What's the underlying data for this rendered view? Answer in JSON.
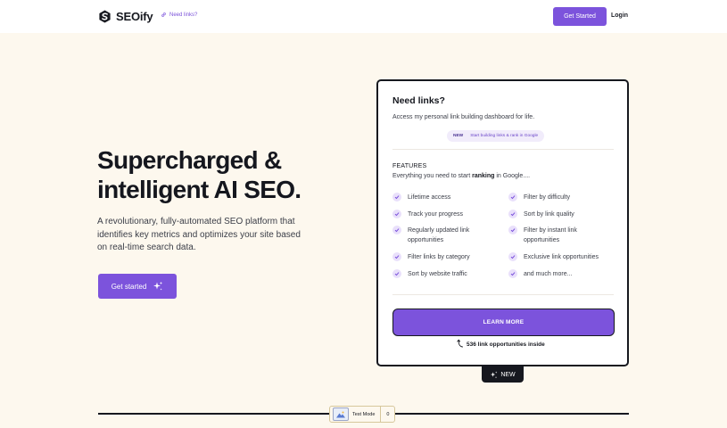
{
  "header": {
    "brand": "SEOify",
    "need_links_label": "Need links?",
    "get_started_label": "Get Started",
    "login_label": "Login"
  },
  "hero": {
    "title_line1": "Supercharged &",
    "title_line2": "intelligent AI SEO.",
    "description": "A revolutionary, fully-automated SEO platform that identifies key metrics and optimizes your site based on real-time search data.",
    "cta_label": "Get started"
  },
  "card": {
    "title": "Need links?",
    "subtitle": "Access my personal link building dashboard for life.",
    "badge_new": "NEW",
    "badge_text": "Start building links & rank in Google",
    "features_heading": "FEATURES",
    "features_sub_pre": "Everything you need to start ",
    "features_sub_bold": "ranking",
    "features_sub_post": " in Google....",
    "features": [
      "Lifetime access",
      "Filter by difficulty",
      "Track your progress",
      "Sort by link quality",
      "Regularly updated link opportunities",
      "Filter by instant link opportunities",
      "Filter links by category",
      "Exclusive link opportunities",
      "Sort by website traffic",
      "and much more..."
    ],
    "learn_more_label": "LEARN MORE",
    "opportunities_text": "536 link opportunities inside"
  },
  "new_tag": "NEW",
  "test_mode": {
    "label": "Test Mode",
    "count": "0"
  },
  "colors": {
    "accent": "#7c53dc",
    "background": "#fdf8ee",
    "dark": "#16181f"
  },
  "icons": [
    "logo-mark-icon",
    "link-icon",
    "sparkle-icon",
    "check-icon",
    "curved-arrow-icon",
    "sparkle-icon",
    "mountain-icon"
  ]
}
